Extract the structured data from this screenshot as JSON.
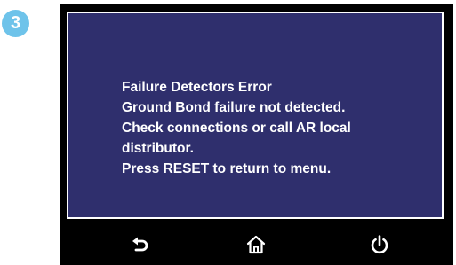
{
  "step_badge": {
    "number": "3",
    "color": "#6ec3ea"
  },
  "screen": {
    "background_color": "#2f2f6d",
    "message_lines": [
      "Failure Detectors Error",
      "Ground Bond failure not detected.",
      "Check connections or call AR local",
      "distributor.",
      "Press RESET to return to menu."
    ]
  },
  "nav_bar": {
    "buttons": [
      {
        "name": "back-button",
        "icon": "back-arrow-icon"
      },
      {
        "name": "home-button",
        "icon": "home-icon"
      },
      {
        "name": "power-button",
        "icon": "power-icon"
      }
    ]
  }
}
